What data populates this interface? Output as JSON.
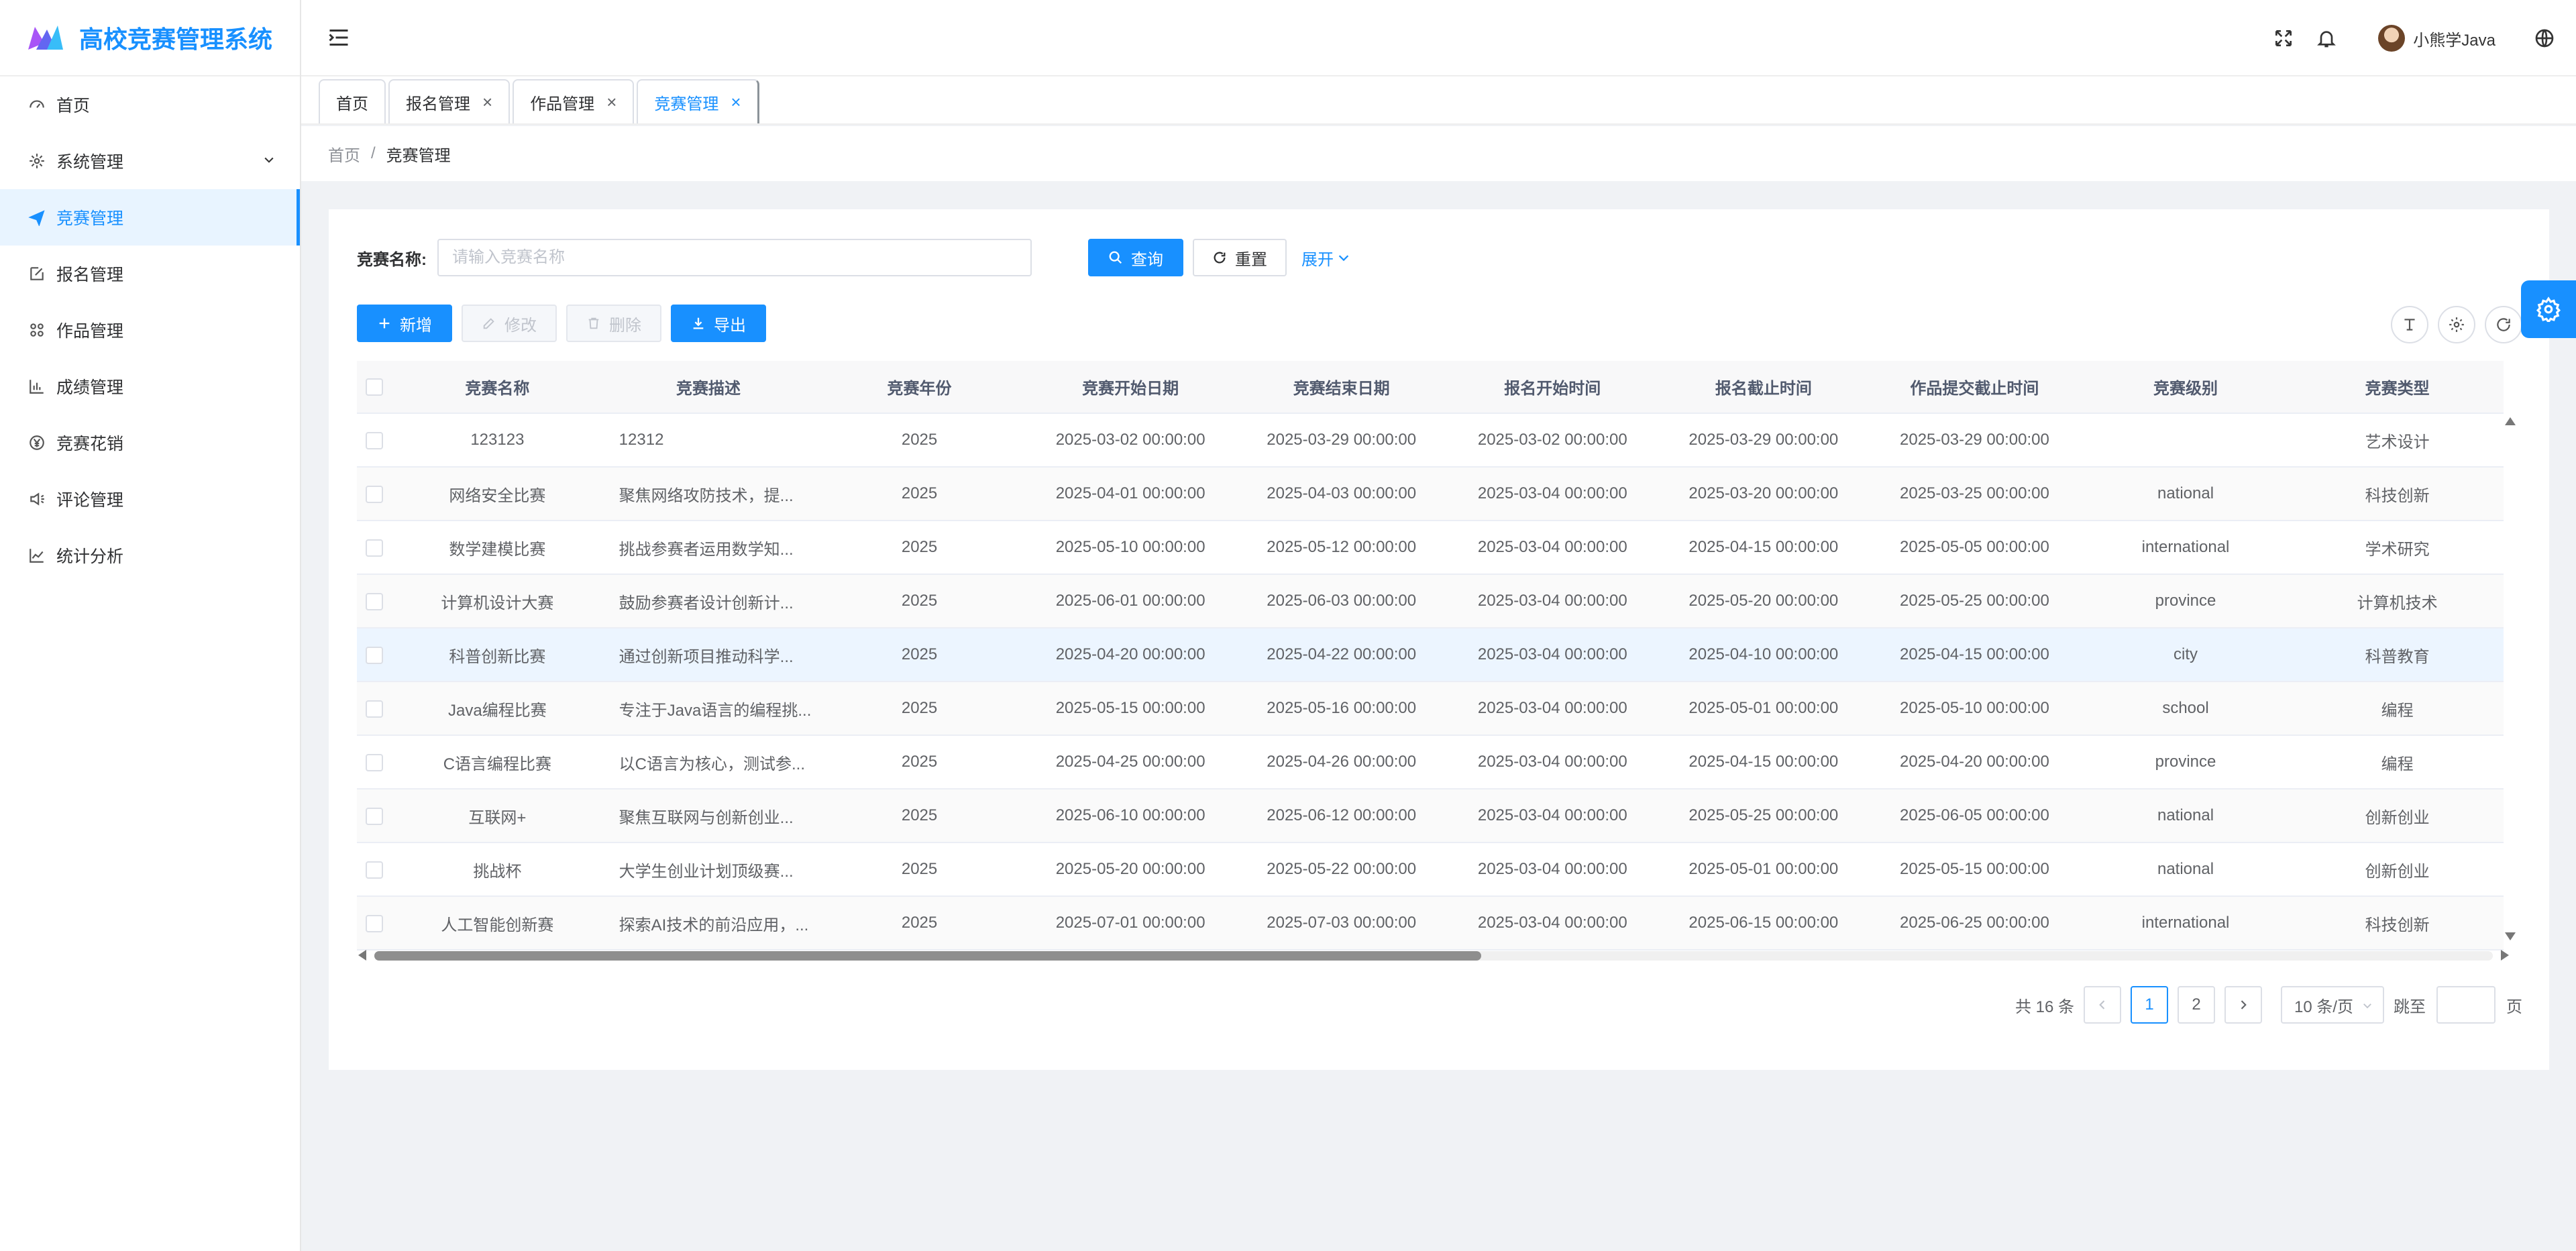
{
  "app": {
    "title": "高校竞赛管理系统"
  },
  "sidebar": {
    "items": [
      {
        "label": "首页",
        "icon": "dashboard-icon"
      },
      {
        "label": "系统管理",
        "icon": "gear-icon",
        "expandable": true
      },
      {
        "label": "竞赛管理",
        "icon": "send-icon",
        "active": true
      },
      {
        "label": "报名管理",
        "icon": "edit-icon"
      },
      {
        "label": "作品管理",
        "icon": "grid-icon"
      },
      {
        "label": "成绩管理",
        "icon": "bar-chart-icon"
      },
      {
        "label": "竞赛花销",
        "icon": "yen-icon"
      },
      {
        "label": "评论管理",
        "icon": "speaker-icon"
      },
      {
        "label": "统计分析",
        "icon": "line-chart-icon"
      }
    ]
  },
  "header": {
    "username": "小熊学Java"
  },
  "tags": [
    {
      "label": "首页",
      "closable": false
    },
    {
      "label": "报名管理",
      "closable": true,
      "close": "×"
    },
    {
      "label": "作品管理",
      "closable": true,
      "close": "×"
    },
    {
      "label": "竞赛管理",
      "closable": true,
      "active": true,
      "close": "×"
    }
  ],
  "breadcrumb": {
    "home": "首页",
    "sep": "/",
    "current": "竞赛管理"
  },
  "search": {
    "label": "竞赛名称:",
    "placeholder": "请输入竞赛名称",
    "search_button": "查询",
    "reset_button": "重置",
    "expand": "展开"
  },
  "toolbar": {
    "add": "新增",
    "edit": "修改",
    "delete": "删除",
    "export": "导出"
  },
  "table": {
    "columns": [
      "竞赛名称",
      "竞赛描述",
      "竞赛年份",
      "竞赛开始日期",
      "竞赛结束日期",
      "报名开始时间",
      "报名截止时间",
      "作品提交截止时间",
      "竞赛级别",
      "竞赛类型"
    ],
    "rows": [
      [
        "123123",
        "12312",
        "2025",
        "2025-03-02 00:00:00",
        "2025-03-29 00:00:00",
        "2025-03-02 00:00:00",
        "2025-03-29 00:00:00",
        "2025-03-29 00:00:00",
        "",
        "艺术设计"
      ],
      [
        "网络安全比赛",
        "聚焦网络攻防技术，提...",
        "2025",
        "2025-04-01 00:00:00",
        "2025-04-03 00:00:00",
        "2025-03-04 00:00:00",
        "2025-03-20 00:00:00",
        "2025-03-25 00:00:00",
        "national",
        "科技创新"
      ],
      [
        "数学建模比赛",
        "挑战参赛者运用数学知...",
        "2025",
        "2025-05-10 00:00:00",
        "2025-05-12 00:00:00",
        "2025-03-04 00:00:00",
        "2025-04-15 00:00:00",
        "2025-05-05 00:00:00",
        "international",
        "学术研究"
      ],
      [
        "计算机设计大赛",
        "鼓励参赛者设计创新计...",
        "2025",
        "2025-06-01 00:00:00",
        "2025-06-03 00:00:00",
        "2025-03-04 00:00:00",
        "2025-05-20 00:00:00",
        "2025-05-25 00:00:00",
        "province",
        "计算机技术"
      ],
      [
        "科普创新比赛",
        "通过创新项目推动科学...",
        "2025",
        "2025-04-20 00:00:00",
        "2025-04-22 00:00:00",
        "2025-03-04 00:00:00",
        "2025-04-10 00:00:00",
        "2025-04-15 00:00:00",
        "city",
        "科普教育"
      ],
      [
        "Java编程比赛",
        "专注于Java语言的编程挑...",
        "2025",
        "2025-05-15 00:00:00",
        "2025-05-16 00:00:00",
        "2025-03-04 00:00:00",
        "2025-05-01 00:00:00",
        "2025-05-10 00:00:00",
        "school",
        "编程"
      ],
      [
        "C语言编程比赛",
        "以C语言为核心，测试参...",
        "2025",
        "2025-04-25 00:00:00",
        "2025-04-26 00:00:00",
        "2025-03-04 00:00:00",
        "2025-04-15 00:00:00",
        "2025-04-20 00:00:00",
        "province",
        "编程"
      ],
      [
        "互联网+",
        "聚焦互联网与创新创业...",
        "2025",
        "2025-06-10 00:00:00",
        "2025-06-12 00:00:00",
        "2025-03-04 00:00:00",
        "2025-05-25 00:00:00",
        "2025-06-05 00:00:00",
        "national",
        "创新创业"
      ],
      [
        "挑战杯",
        "大学生创业计划顶级赛...",
        "2025",
        "2025-05-20 00:00:00",
        "2025-05-22 00:00:00",
        "2025-03-04 00:00:00",
        "2025-05-01 00:00:00",
        "2025-05-15 00:00:00",
        "national",
        "创新创业"
      ],
      [
        "人工智能创新赛",
        "探索AI技术的前沿应用，...",
        "2025",
        "2025-07-01 00:00:00",
        "2025-07-03 00:00:00",
        "2025-03-04 00:00:00",
        "2025-06-15 00:00:00",
        "2025-06-25 00:00:00",
        "international",
        "科技创新"
      ]
    ],
    "hover_row": 4
  },
  "pagination": {
    "total": "共 16 条",
    "pages": [
      "1",
      "2"
    ],
    "current": "1",
    "page_size": "10 条/页",
    "jump_label": "跳至",
    "page_suffix": "页"
  },
  "colors": {
    "primary": "#1890ff",
    "active_bg": "#e8f4ff",
    "hover_row": "#ecf5ff"
  }
}
